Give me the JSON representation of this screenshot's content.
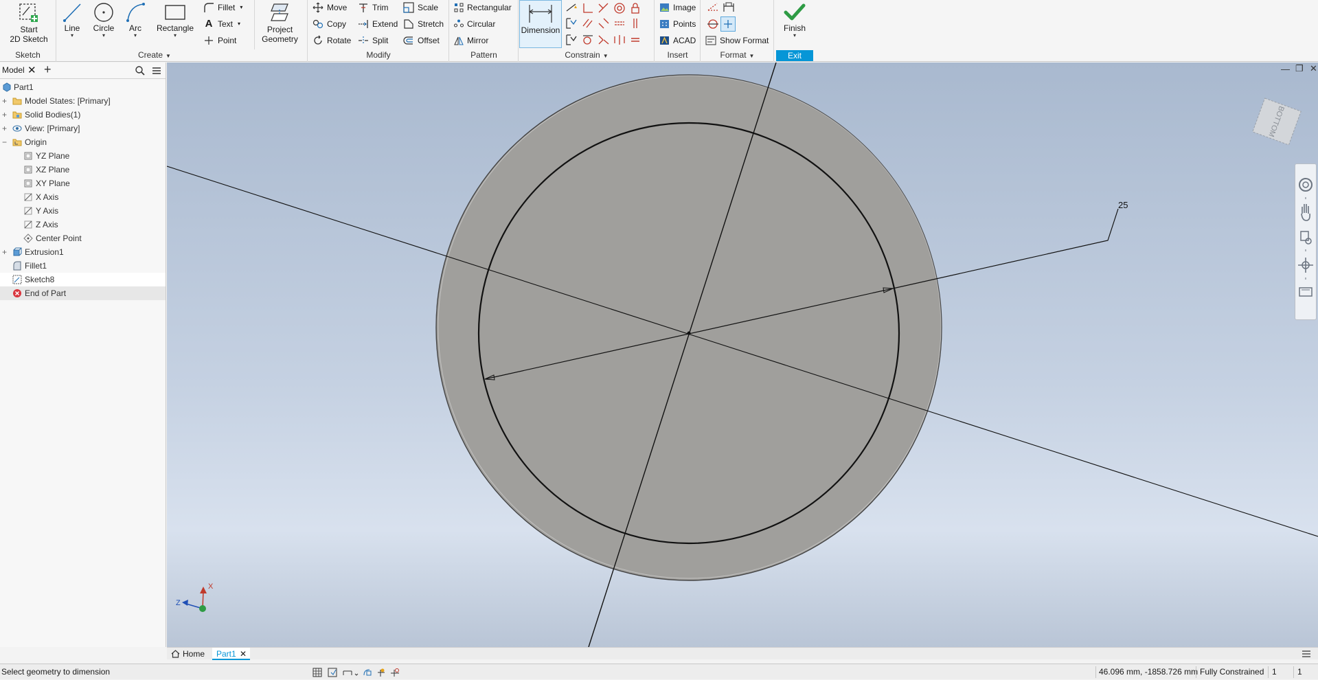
{
  "ribbon": {
    "sketch_panel": {
      "label": "Sketch",
      "start_sketch": [
        "Start",
        "2D Sketch"
      ]
    },
    "create_panel": {
      "label": "Create",
      "line": "Line",
      "circle": "Circle",
      "arc": "Arc",
      "rectangle": "Rectangle",
      "fillet": "Fillet",
      "text": "Text",
      "point": "Point",
      "project_geometry": [
        "Project",
        "Geometry"
      ]
    },
    "modify_panel": {
      "label": "Modify",
      "move": "Move",
      "trim": "Trim",
      "scale": "Scale",
      "copy": "Copy",
      "extend": "Extend",
      "stretch": "Stretch",
      "rotate": "Rotate",
      "split": "Split",
      "offset": "Offset"
    },
    "pattern_panel": {
      "label": "Pattern",
      "rectangular": "Rectangular",
      "circular": "Circular",
      "mirror": "Mirror"
    },
    "constrain_panel": {
      "label": "Constrain",
      "dimension": "Dimension"
    },
    "insert_panel": {
      "label": "Insert",
      "image": "Image",
      "points": "Points",
      "acad": "ACAD"
    },
    "format_panel": {
      "label": "Format",
      "show_format": "Show Format"
    },
    "exit_panel": {
      "label": "Exit",
      "finish": "Finish"
    }
  },
  "browser": {
    "tab": "Model",
    "tree": [
      {
        "label": "Part1",
        "indent": 0
      },
      {
        "label": "Model States: [Primary]",
        "indent": 1
      },
      {
        "label": "Solid Bodies(1)",
        "indent": 1
      },
      {
        "label": "View: [Primary]",
        "indent": 1
      },
      {
        "label": "Origin",
        "indent": 1
      },
      {
        "label": "YZ Plane",
        "indent": 2
      },
      {
        "label": "XZ Plane",
        "indent": 2
      },
      {
        "label": "XY Plane",
        "indent": 2
      },
      {
        "label": "X Axis",
        "indent": 2
      },
      {
        "label": "Y Axis",
        "indent": 2
      },
      {
        "label": "Z Axis",
        "indent": 2
      },
      {
        "label": "Center Point",
        "indent": 2
      },
      {
        "label": "Extrusion1",
        "indent": 1
      },
      {
        "label": "Fillet1",
        "indent": 1
      },
      {
        "label": "Sketch8",
        "indent": 1
      },
      {
        "label": "End of Part",
        "indent": 1
      }
    ]
  },
  "viewport": {
    "dimension_value": "25",
    "viewcube_face": "BOTTOM",
    "triad": {
      "x": "X",
      "z": "Z"
    }
  },
  "doc_tabs": {
    "home": "Home",
    "part": "Part1"
  },
  "status": {
    "prompt": "Select geometry to dimension",
    "coordinates": "46.096 mm, -1858.726 mm",
    "constraint_state": "Fully Constrained",
    "count1": "1",
    "count2": "1"
  },
  "colors": {
    "accent": "#0696d7",
    "part_face": "#a09f9c",
    "sketch_line": "#111111"
  }
}
